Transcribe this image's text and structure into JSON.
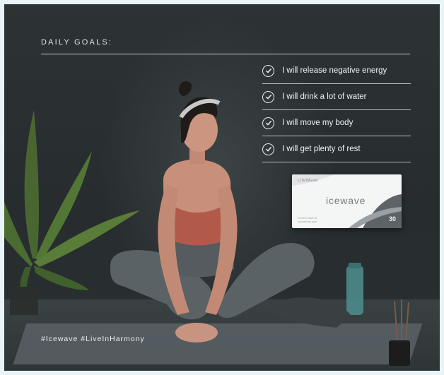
{
  "title": "DAILY GOALS:",
  "goals": [
    "I will release negative energy",
    "I will drink a lot of water",
    "I will move my body",
    "I will get plenty of rest"
  ],
  "product": {
    "brand": "LifeWave",
    "name": "icewave",
    "count": "30",
    "fine_print": "For the relief of occasional pain"
  },
  "hashtags": "#Icewave #LiveInHarmony",
  "colors": {
    "background": "#2a3032",
    "text": "#eef1f2",
    "frame": "#e9f4f9"
  }
}
